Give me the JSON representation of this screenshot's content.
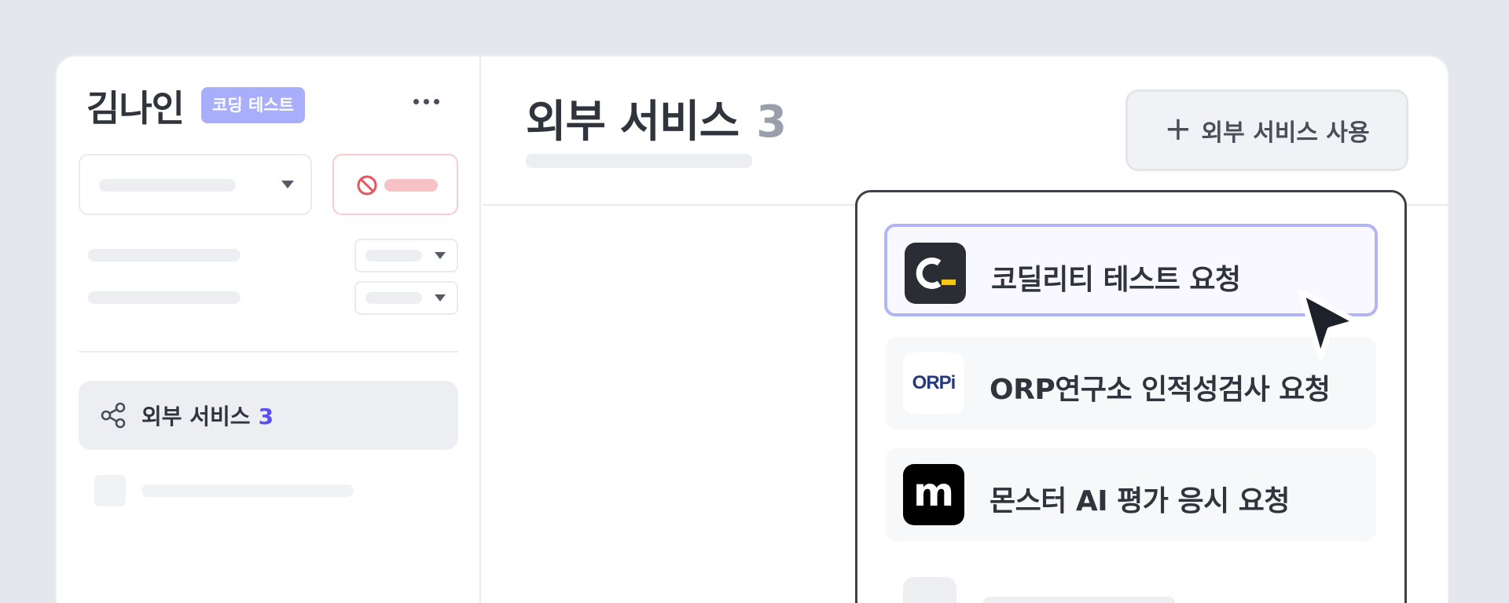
{
  "sidebar": {
    "user_name": "김나인",
    "badge": "코딩 테스트",
    "external_services": {
      "label": "외부 서비스",
      "count": "3"
    }
  },
  "main": {
    "title": "외부 서비스",
    "count": "3",
    "add_button": {
      "icon": "plus-icon",
      "label": "외부 서비스 사용"
    }
  },
  "dropdown": {
    "options": [
      {
        "label": "코딜리티 테스트 요청",
        "icon": "codility-logo"
      },
      {
        "label": "ORP연구소 인적성검사 요청",
        "icon": "orpi-logo",
        "logo_text": "ORPi"
      },
      {
        "label": "몬스터 AI 평가 응시 요청",
        "icon": "monster-logo",
        "logo_text": "m"
      }
    ]
  },
  "colors": {
    "accent": "#5b4ff0",
    "badge": "#a9aefa",
    "active_outline": "#b1b5f6",
    "danger_outline": "#f7cdcf"
  }
}
